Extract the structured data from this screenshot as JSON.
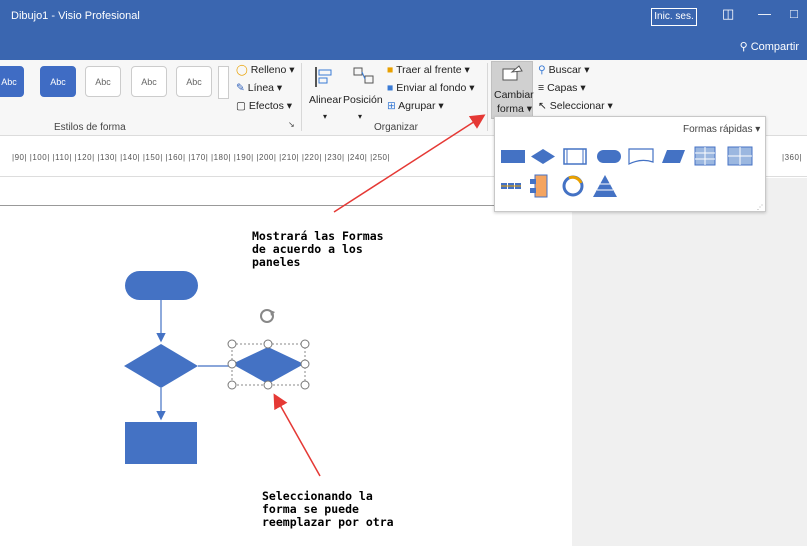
{
  "window": {
    "title": "Dibujo1  -  Visio Profesional",
    "sign_in": "Inic. ses.",
    "minimize": "—",
    "restore": "□"
  },
  "share": {
    "label": "Compartir"
  },
  "ribbon": {
    "styles": [
      "Abc",
      "Abc",
      "Abc",
      "Abc",
      "Abc"
    ],
    "fill": "Relleno",
    "line": "Línea",
    "effects": "Efectos",
    "styles_group": "Estilos de forma",
    "align": "Alinear",
    "position": "Posición",
    "bring_front": "Traer al frente",
    "send_back": "Enviar al fondo",
    "group": "Agrupar",
    "organize_group": "Organizar",
    "change_shape_line1": "Cambiar",
    "change_shape_line2": "forma",
    "find": "Buscar",
    "layers": "Capas",
    "select": "Seleccionar"
  },
  "ruler": {
    "ticks": "|90| |100| |110| |120| |130| |140| |150| |160| |170| |180| |190| |200| |210| |220| |230| |240| |250|",
    "tick_right": "|360|"
  },
  "quick_shapes": {
    "title": "Formas rápidas"
  },
  "annotations": {
    "top": "Mostrará las Formas\nde acuerdo a los\npaneles",
    "bottom": "Seleccionando la\nforma se puede\nreemplazar por otra"
  }
}
